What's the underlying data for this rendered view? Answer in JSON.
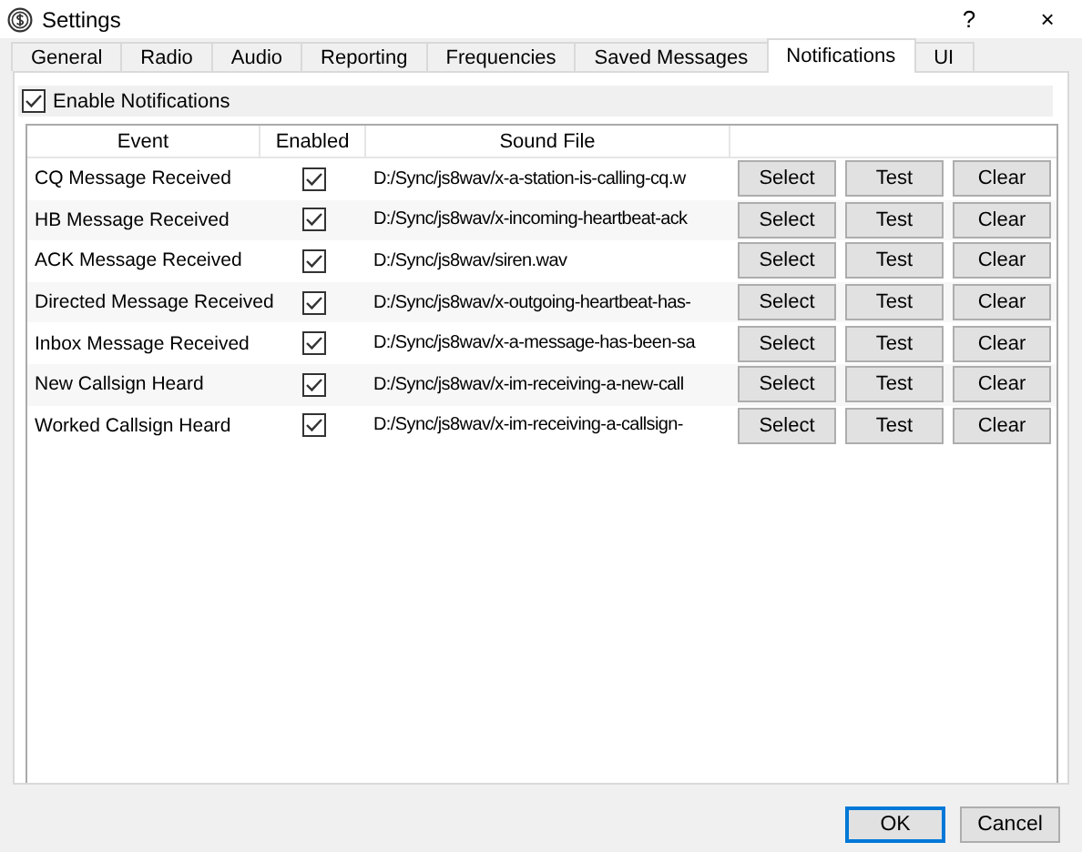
{
  "window": {
    "title": "Settings",
    "help": "?",
    "close": "×"
  },
  "tabs": [
    {
      "label": "General",
      "selected": false
    },
    {
      "label": "Radio",
      "selected": false
    },
    {
      "label": "Audio",
      "selected": false
    },
    {
      "label": "Reporting",
      "selected": false
    },
    {
      "label": "Frequencies",
      "selected": false
    },
    {
      "label": "Saved Messages",
      "selected": false
    },
    {
      "label": "Notifications",
      "selected": true
    },
    {
      "label": "UI",
      "selected": false
    }
  ],
  "enable": {
    "label": "Enable Notifications",
    "checked": true
  },
  "table": {
    "columns": [
      "Event",
      "Enabled",
      "Sound File"
    ],
    "rows": [
      {
        "event": "CQ Message Received",
        "enabled": true,
        "file": "D:/Sync/js8wav/x-a-station-is-calling-cq.w",
        "buttons": [
          "Select",
          "Test",
          "Clear"
        ]
      },
      {
        "event": "HB Message Received",
        "enabled": true,
        "file": "D:/Sync/js8wav/x-incoming-heartbeat-ack",
        "buttons": [
          "Select",
          "Test",
          "Clear"
        ]
      },
      {
        "event": "ACK Message Received",
        "enabled": true,
        "file": "D:/Sync/js8wav/siren.wav",
        "buttons": [
          "Select",
          "Test",
          "Clear"
        ]
      },
      {
        "event": "Directed Message Received",
        "enabled": true,
        "file": "D:/Sync/js8wav/x-outgoing-heartbeat-has-",
        "buttons": [
          "Select",
          "Test",
          "Clear"
        ]
      },
      {
        "event": "Inbox Message Received",
        "enabled": true,
        "file": "D:/Sync/js8wav/x-a-message-has-been-sa",
        "buttons": [
          "Select",
          "Test",
          "Clear"
        ]
      },
      {
        "event": "New Callsign Heard",
        "enabled": true,
        "file": "D:/Sync/js8wav/x-im-receiving-a-new-call",
        "buttons": [
          "Select",
          "Test",
          "Clear"
        ]
      },
      {
        "event": "Worked Callsign Heard",
        "enabled": true,
        "file": "D:/Sync/js8wav/x-im-receiving-a-callsign-",
        "buttons": [
          "Select",
          "Test",
          "Clear"
        ]
      }
    ]
  },
  "buttons": [
    {
      "label": "OK",
      "selected": true
    },
    {
      "label": "Cancel",
      "selected": false
    }
  ]
}
